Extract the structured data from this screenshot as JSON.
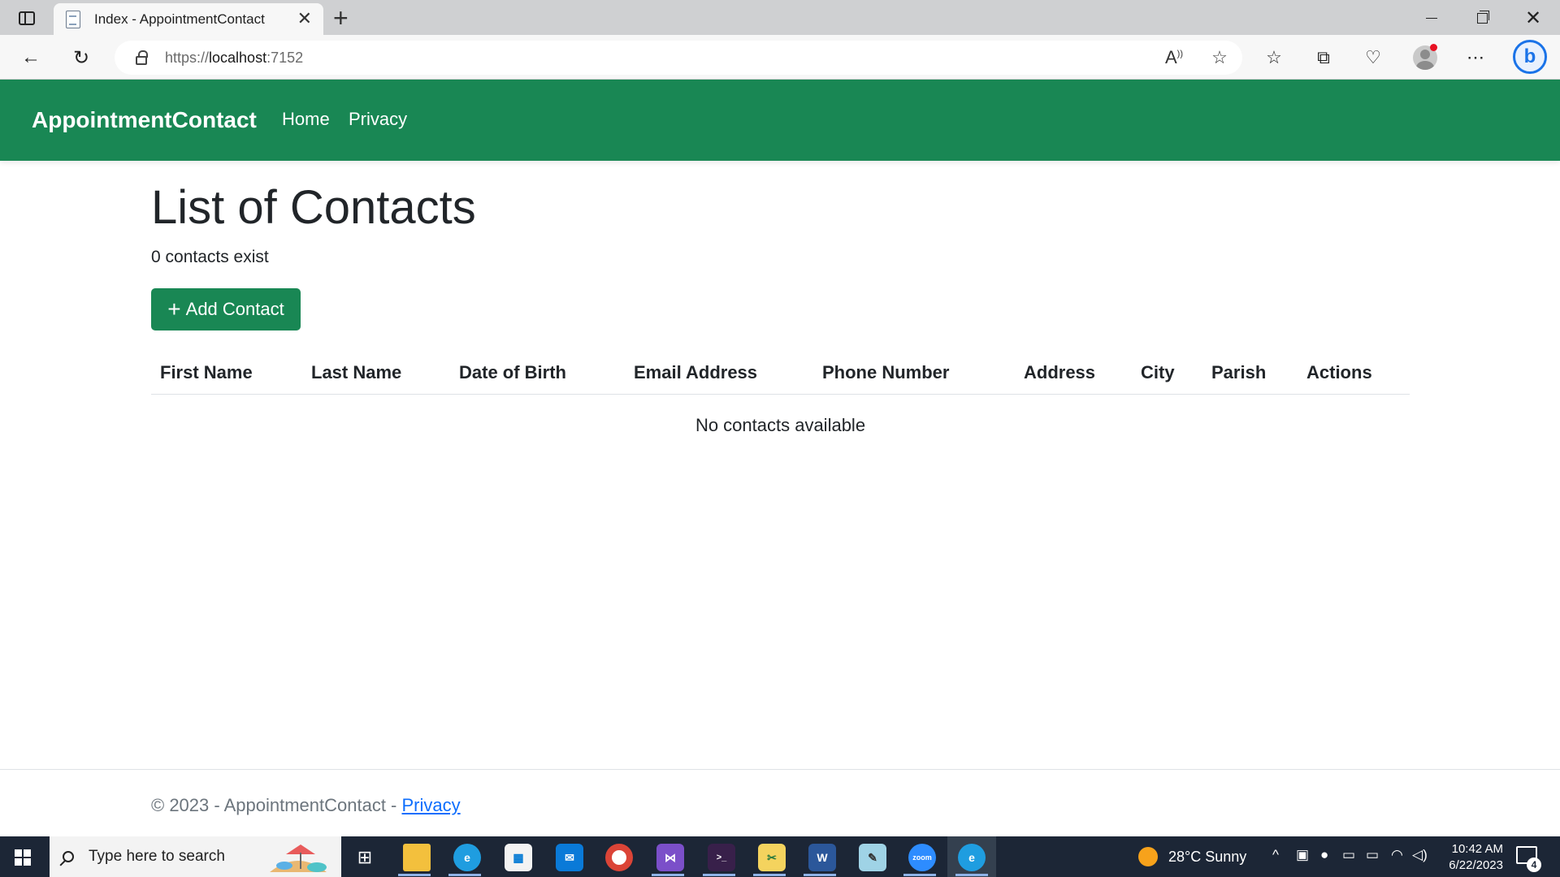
{
  "browser": {
    "tab_title": "Index - AppointmentContact",
    "url_prefix": "https://",
    "url_host": "localhost",
    "url_port": ":7152",
    "icons": [
      "sidebar-icon",
      "page-icon",
      "close-icon",
      "plus-icon",
      "back-icon",
      "refresh-icon",
      "lock-icon",
      "read-aloud-icon",
      "star-icon",
      "favorites-icon",
      "collections-icon",
      "performance-icon",
      "profile-icon",
      "more-icon",
      "bing-icon"
    ]
  },
  "navbar": {
    "brand": "AppointmentContact",
    "links": [
      "Home",
      "Privacy"
    ],
    "color": "#198754"
  },
  "main": {
    "title": "List of Contacts",
    "count_text": "0 contacts exist",
    "add_button_icon": "+",
    "add_button_label": "Add Contact"
  },
  "table": {
    "columns": [
      "First Name",
      "Last Name",
      "Date of Birth",
      "Email Address",
      "Phone Number",
      "Address",
      "City",
      "Parish",
      "Actions"
    ],
    "empty_message": "No contacts available"
  },
  "footer": {
    "text": "© 2023 - AppointmentContact - ",
    "link": "Privacy"
  },
  "taskbar": {
    "search_placeholder": "Type here to search",
    "weather": "28°C  Sunny",
    "time": "10:42 AM",
    "date": "6/22/2023",
    "notification_count": "4",
    "apps": [
      "task-view",
      "file-explorer",
      "edge",
      "microsoft-store",
      "mail",
      "chrome",
      "visual-studio",
      "terminal",
      "sticky-tools",
      "word",
      "notepad",
      "zoom",
      "edge-active"
    ]
  }
}
